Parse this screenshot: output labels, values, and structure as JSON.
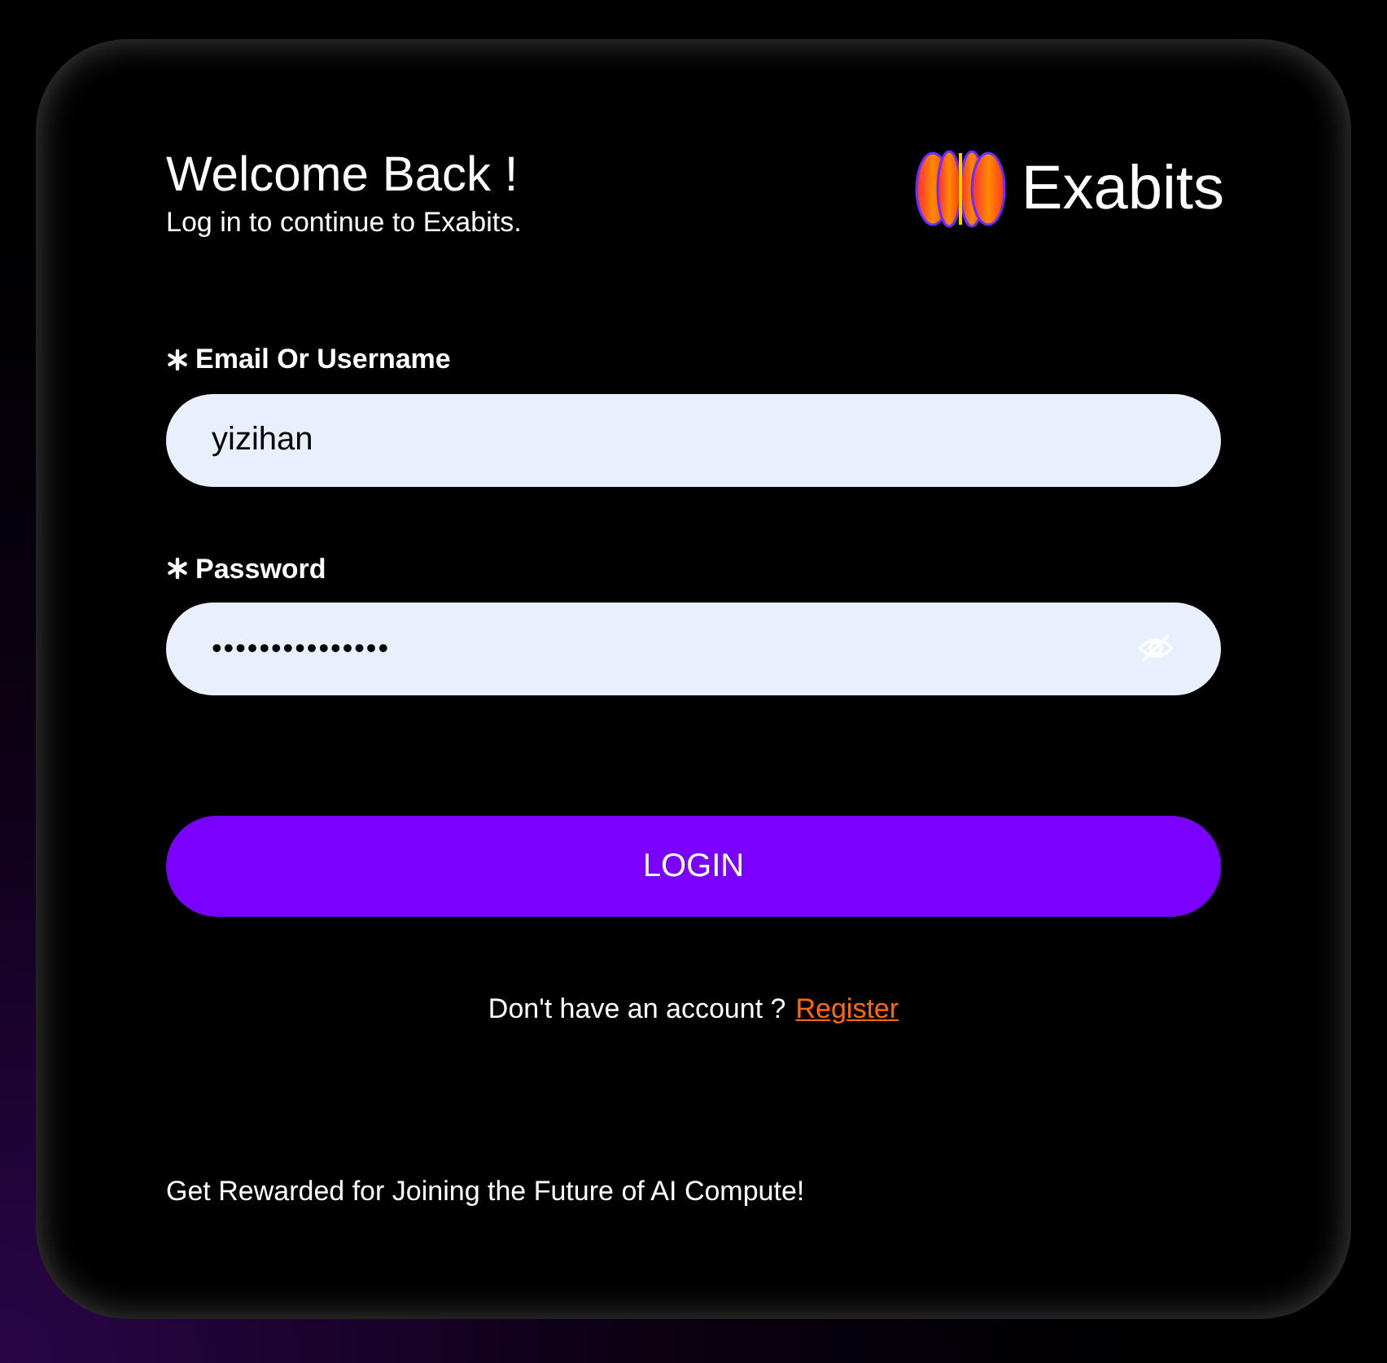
{
  "header": {
    "title": "Welcome Back !",
    "subtitle": "Log in to continue to Exabits.",
    "brand": "Exabits"
  },
  "fields": [
    {
      "kind": "text",
      "label": "Email Or Username",
      "required": true,
      "value": "yizihan"
    },
    {
      "kind": "password",
      "label": "Password",
      "required": true,
      "value": "•••••••••••••••"
    }
  ],
  "login_button": "LOGIN",
  "register_prompt": {
    "text": "Don't have an account ?",
    "link": "Register"
  },
  "footer": "Get Rewarded for Joining the Future of AI Compute!"
}
